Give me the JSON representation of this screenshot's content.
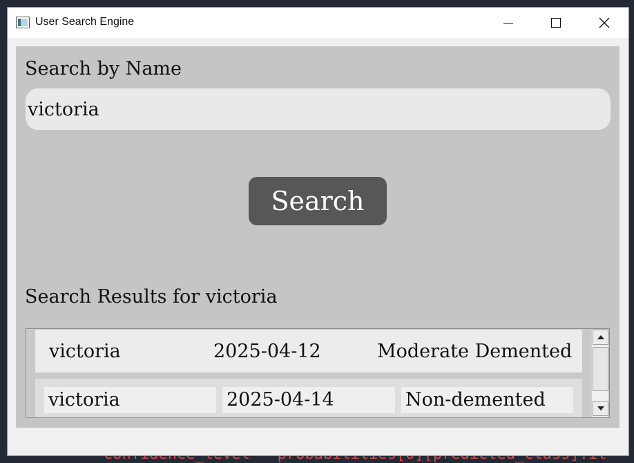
{
  "window": {
    "title": "User Search Engine"
  },
  "search": {
    "label": "Search by Name",
    "value": "victoria",
    "button_label": "Search"
  },
  "results": {
    "heading": "Search Results for victoria",
    "rows": [
      {
        "name": "victoria",
        "date": "2025-04-12",
        "diagnosis": "Moderate Demented"
      },
      {
        "name": "victoria",
        "date": "2025-04-14",
        "diagnosis": "Non-demented"
      }
    ]
  },
  "background": {
    "code_bottom": "confidence_level = probabilities[0][predicted_class].it"
  },
  "colors": {
    "content_bg": "#c5c5c5",
    "button_bg": "#575757",
    "input_bg": "#e9e9e9"
  },
  "icons": [
    "app-icon",
    "minimize-icon",
    "maximize-icon",
    "close-icon",
    "scroll-up-icon",
    "scroll-down-icon"
  ]
}
